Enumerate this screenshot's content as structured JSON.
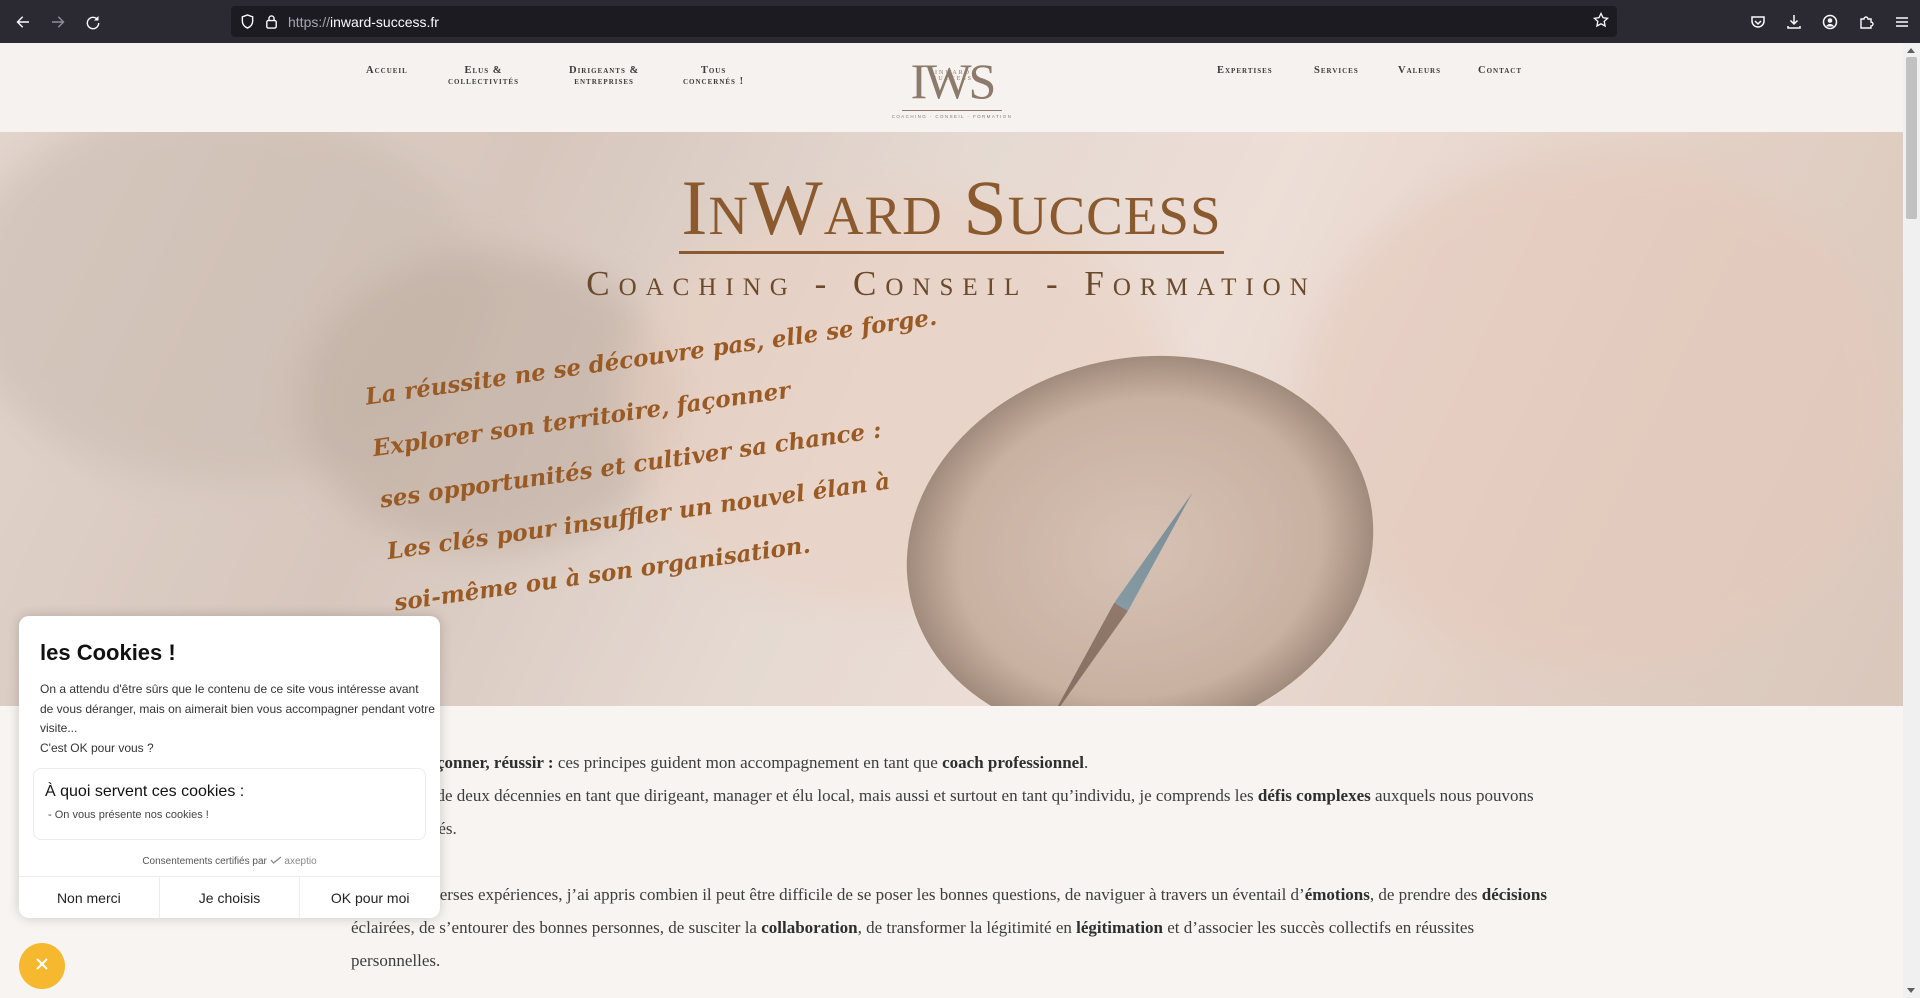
{
  "browser": {
    "url_prefix": "https://",
    "url_domain": "inward-success.fr",
    "toolbar_icons": [
      "back-icon",
      "forward-icon",
      "reload-icon",
      "pocket-icon",
      "download-icon",
      "account-icon",
      "extensions-icon",
      "menu-icon"
    ]
  },
  "nav": {
    "left": [
      {
        "line1": "Accueil",
        "line2": ""
      },
      {
        "line1": "Elus &",
        "line2": "collectivités"
      },
      {
        "line1": "Dirigeants &",
        "line2": "entreprises"
      },
      {
        "line1": "Tous",
        "line2": "concernés !"
      }
    ],
    "right": [
      {
        "line1": "Expertises"
      },
      {
        "line1": "Services"
      },
      {
        "line1": "Valeurs"
      },
      {
        "line1": "Contact"
      }
    ],
    "logo": {
      "mark": "IWS",
      "small": "INWARD SUCCESS",
      "tagline": "COACHING · CONSEIL · FORMATION"
    }
  },
  "hero": {
    "title": "InWard Success",
    "subtitle": "Coaching - Conseil - Formation",
    "quote": [
      "La réussite ne se découvre pas, elle se forge.",
      "Explorer son territoire, façonner",
      "ses opportunités et cultiver sa chance :",
      "Les clés pour insuffler un nouvel élan à",
      "soi-même ou à son organisation."
    ]
  },
  "content": {
    "p1_a": "Explorer, façonner, réussir :",
    "p1_b": " ces principes guident mon accompagnement en tant que ",
    "p1_c": "coach professionnel",
    "p1_d": ".",
    "p1_e": "Fort de plus de deux décennies en tant que dirigeant, manager et élu local, mais aussi et surtout en tant qu’individu, je comprends les ",
    "p1_f": "défis complexes",
    "p1_g": " auxquels nous pouvons être confrontés.",
    "p2_a": "À travers diverses expériences, j’ai appris combien il peut être difficile de se poser les bonnes questions, de naviguer à travers un éventail d’",
    "p2_b": "émotions",
    "p2_c": ", de prendre des ",
    "p2_d": "décisions",
    "p2_e": " éclairées, de s’entourer des bonnes personnes, de susciter la ",
    "p2_f": "collaboration",
    "p2_g": ", de transformer la légitimité en ",
    "p2_h": "légitimation",
    "p2_i": " et d’associer les succès collectifs en réussites personnelles."
  },
  "cookie": {
    "title": "les Cookies !",
    "text": "On a attendu d'être sûrs que le contenu de ce site vous intéresse avant de vous déranger, mais on aimerait bien vous accompagner pendant votre visite...",
    "question": "C'est OK pour vous ?",
    "box_title": "À quoi servent ces cookies :",
    "box_item": "- On vous présente nos cookies !",
    "cert": "Consentements certifiés par",
    "cert_brand": "axeptio",
    "buttons": [
      "Non merci",
      "Je choisis",
      "OK pour moi"
    ]
  },
  "colors": {
    "title_gold": "#8a5a2e",
    "quote_orange": "#9a5a24",
    "cookie_toggle": "#f5b82e"
  }
}
